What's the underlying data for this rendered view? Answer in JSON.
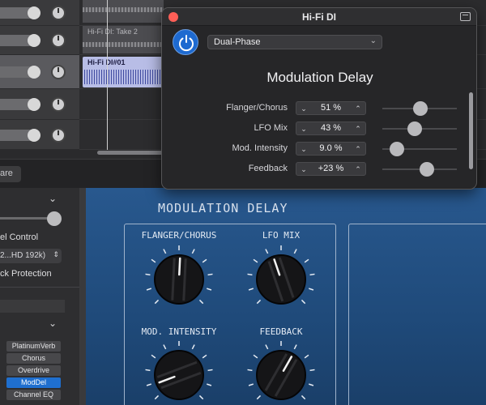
{
  "arrangement": {
    "take2_label": "Hi-Fi DI: Take 2",
    "region_label": "Hi-Fi DI#01"
  },
  "toolbar": {
    "share_label": "are"
  },
  "inspector": {
    "level_control_label": "el Control",
    "format_value": "2...HD 192k)",
    "clip_protection_label": "ck Protection",
    "plugins": [
      "PlatinumVerb",
      "Chorus",
      "Overdrive",
      "ModDel",
      "Channel EQ"
    ],
    "active_plugin": "ModDel"
  },
  "plugin_ui": {
    "title": "MODULATION DELAY",
    "knobs": [
      {
        "label": "FLANGER/CHORUS",
        "value": 0.51
      },
      {
        "label": "LFO MIX",
        "value": 0.43
      },
      {
        "label": "MOD. INTENSITY",
        "value": 0.09
      },
      {
        "label": "FEEDBACK",
        "value": 0.61
      }
    ]
  },
  "plugin_window": {
    "title": "Hi-Fi DI",
    "preset": "Dual-Phase",
    "heading": "Modulation Delay",
    "params": [
      {
        "label": "Flanger/Chorus",
        "value": "51 %",
        "level": 0.51
      },
      {
        "label": "LFO Mix",
        "value": "43 %",
        "level": 0.43
      },
      {
        "label": "Mod. Intensity",
        "value": "9.0 %",
        "level": 0.2
      },
      {
        "label": "Feedback",
        "value": "+23 %",
        "level": 0.6
      }
    ],
    "stepper_down": "⌄",
    "stepper_up": "⌃"
  },
  "colors": {
    "accent_blue": "#1f6fcf",
    "plugin_bg": "#28588e",
    "region_blue": "#b8bde6",
    "close_red": "#ff5f57"
  }
}
